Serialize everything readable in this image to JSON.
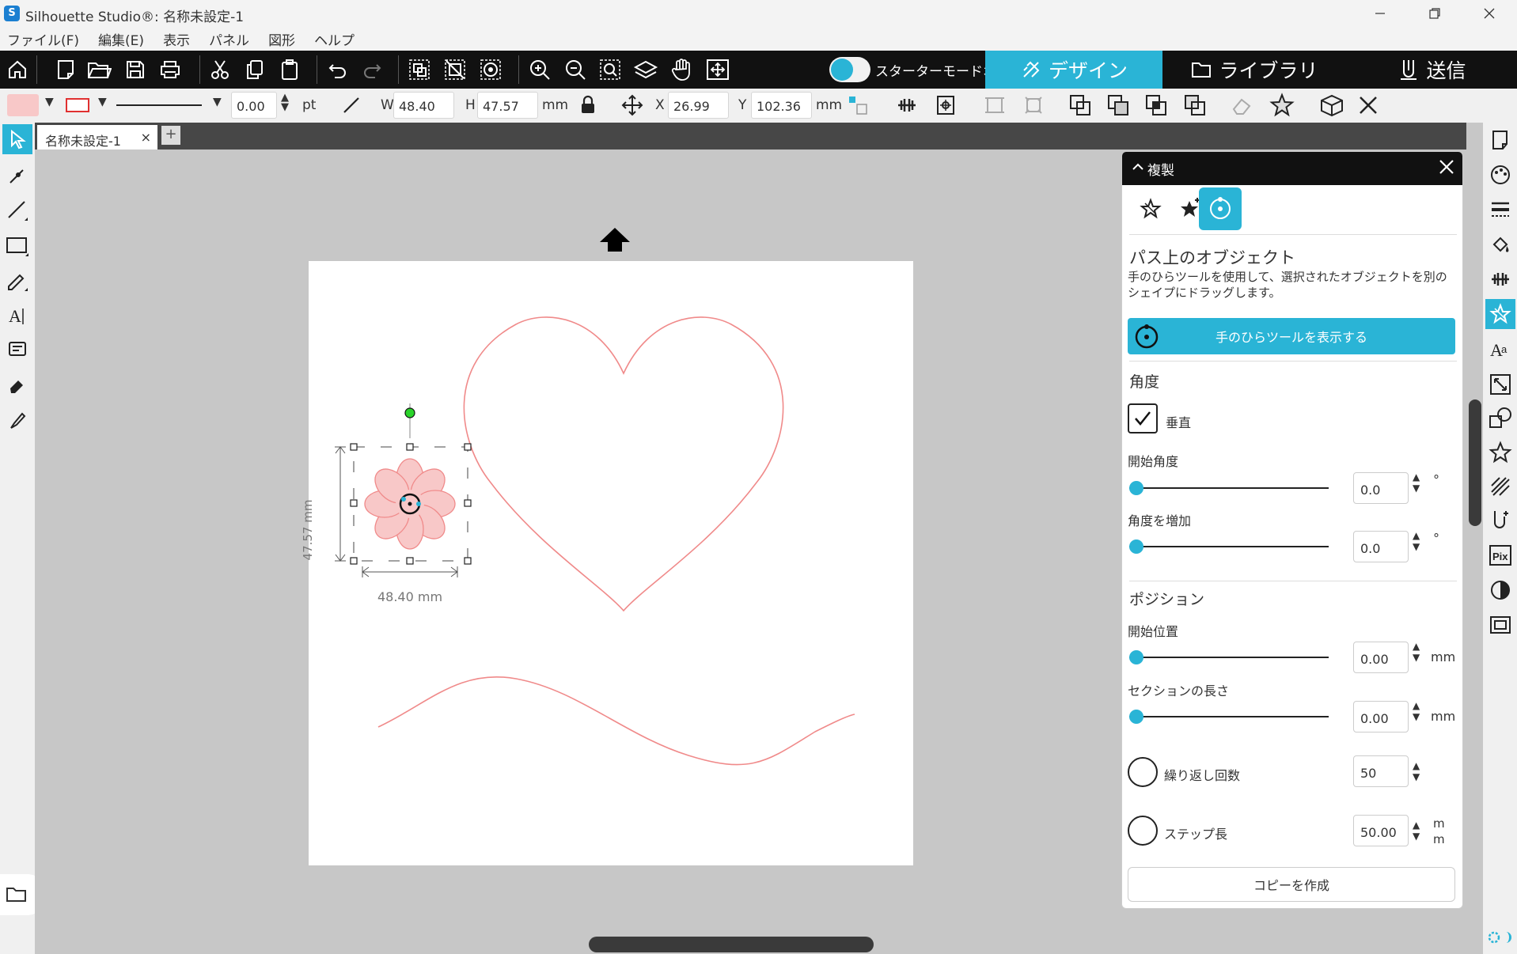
{
  "window": {
    "title": "Silhouette Studio®: 名称未設定-1",
    "app_icon": "S"
  },
  "menu": [
    "ファイル(F)",
    "編集(E)",
    "表示",
    "パネル",
    "図形",
    "ヘルプ"
  ],
  "toolbar": {
    "starter_mode_label": "スターターモードオフ",
    "tabs": {
      "design": "デザイン",
      "library": "ライブラリ",
      "send": "送信"
    }
  },
  "properties": {
    "line_width": "0.00",
    "line_unit": "pt",
    "w_label": "W",
    "w_value": "48.40",
    "h_label": "H",
    "h_value": "47.57",
    "size_unit": "mm",
    "x_label": "X",
    "x_value": "26.99",
    "y_label": "Y",
    "y_value": "102.36",
    "pos_unit": "mm",
    "fill_color": "#f8c8c8",
    "line_color": "#e03030"
  },
  "document": {
    "tab_name": "名称未設定-1",
    "close": "×",
    "add": "+"
  },
  "canvas": {
    "selection_height_label": "47.57 mm",
    "selection_width_label": "48.40 mm"
  },
  "panel": {
    "title": "複製",
    "section_title": "パス上のオブジェクト",
    "description": "手のひらツールを使用して、選択されたオブジェクトを別のシェイプにドラッグします。",
    "show_hand_button": "手のひらツールを表示する",
    "angle_header": "角度",
    "vertical_label": "垂直",
    "vertical_checked": true,
    "start_angle_label": "開始角度",
    "start_angle_value": "0.0",
    "increase_angle_label": "角度を増加",
    "increase_angle_value": "0.0",
    "degree_unit": "°",
    "position_header": "ポジション",
    "start_position_label": "開始位置",
    "start_position_value": "0.00",
    "section_length_label": "セクションの長さ",
    "section_length_value": "0.00",
    "mm_unit": "mm",
    "repeat_label": "繰り返し回数",
    "repeat_value": "50",
    "step_label": "ステップ長",
    "step_value": "50.00",
    "step_unit_top": "m",
    "step_unit_bottom": "m",
    "make_copy_button": "コピーを作成"
  },
  "colors": {
    "accent": "#2ab4d6",
    "toolbar_bg": "#111111",
    "canvas_bg": "#c7c7c7",
    "shape_stroke": "#f08a8a",
    "flower_fill": "#f8c8c8"
  }
}
